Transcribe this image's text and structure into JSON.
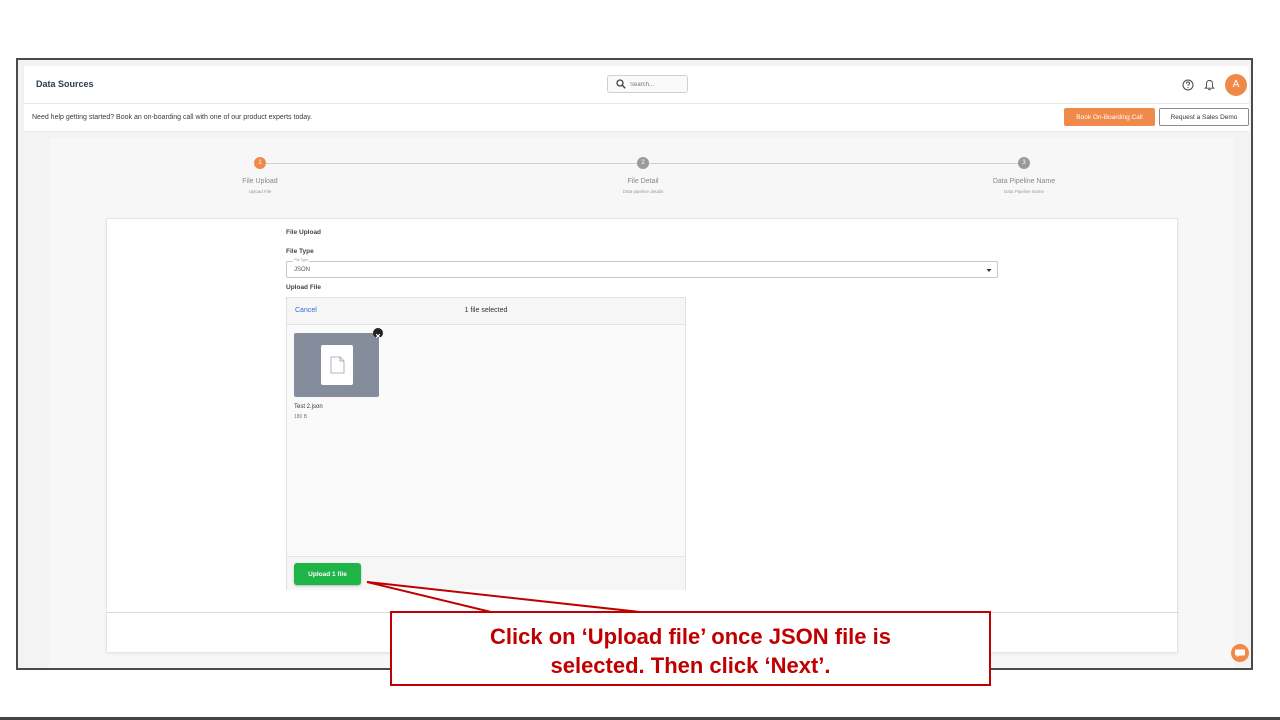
{
  "header": {
    "title": "Data Sources",
    "search_placeholder": "Search...",
    "avatar_initial": "A"
  },
  "banner": {
    "text": "Need help getting started? Book an on-boarding call with one of our product experts today.",
    "onboard_button": "Book On-Boarding Call",
    "demo_button": "Request a Sales Demo"
  },
  "stepper": {
    "steps": [
      {
        "number": "1",
        "title": "File Upload",
        "subtitle": "Upload File",
        "active": true
      },
      {
        "number": "2",
        "title": "File Detail",
        "subtitle": "Data pipeline details",
        "active": false
      },
      {
        "number": "3",
        "title": "Data Pipeline Name",
        "subtitle": "Data Pipeline Name",
        "active": false
      }
    ]
  },
  "form": {
    "section_title": "File Upload",
    "file_type_label": "File Type",
    "file_type_floating": "File Type",
    "file_type_value": "JSON",
    "upload_label": "Upload File"
  },
  "uploader": {
    "cancel": "Cancel",
    "selected_text": "1 file selected",
    "file_name": "Test 2.json",
    "file_size": "180 B",
    "upload_button": "Upload 1 file"
  },
  "callout": {
    "line1": "Click on ‘Upload file’ once JSON  file is",
    "line2": "selected. Then click ‘Next’."
  },
  "colors": {
    "accent": "#f08a4b",
    "upload_green": "#1fb447",
    "callout_red": "#c00000",
    "link_blue": "#2f6fd6"
  }
}
